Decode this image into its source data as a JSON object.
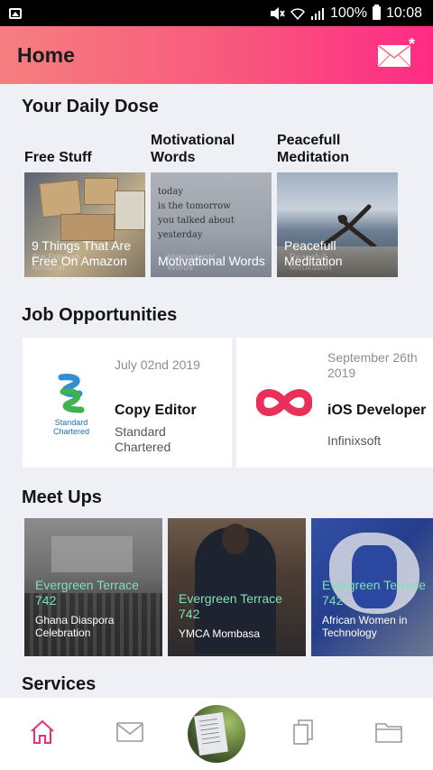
{
  "status_bar": {
    "battery": "100%",
    "time": "10:08"
  },
  "header": {
    "title": "Home",
    "mail_badge": "*"
  },
  "daily_dose": {
    "title": "Your Daily Dose",
    "items": [
      {
        "label": "Free Stuff",
        "caption": "9 Things That Are Free On Amazon",
        "ghost": "Are Free on Amazon"
      },
      {
        "label": "Motivational Words",
        "caption": "Motivational Words",
        "ghost": "Motivational Words",
        "poem": [
          "today",
          "is the tomorrow",
          "you talked about",
          "yesterday"
        ]
      },
      {
        "label": "Peacefull Meditation",
        "caption": "Peacefull Meditation",
        "ghost": "Peacefull Meditation"
      }
    ]
  },
  "jobs": {
    "title": "Job Opportunities",
    "items": [
      {
        "date": "July 02nd 2019",
        "title": "Copy Editor",
        "company": "Standard Chartered",
        "logo_text": "Standard Chartered"
      },
      {
        "date": "September 26th 2019",
        "title": "iOS Developer",
        "company": "Infinixsoft"
      }
    ]
  },
  "meetups": {
    "title": "Meet Ups",
    "items": [
      {
        "location": "Evergreen Terrace 742",
        "name": "Ghana Diaspora Celebration"
      },
      {
        "location": "Evergreen Terrace 742",
        "name": "YMCA Mombasa"
      },
      {
        "location": "Evergreen Terrace 742",
        "name": "African Women in Technology"
      }
    ]
  },
  "services": {
    "title": "Services"
  },
  "colors": {
    "accent": "#f8577e",
    "meetup_location": "#7fe0b8",
    "home_active": "#e8336f"
  }
}
